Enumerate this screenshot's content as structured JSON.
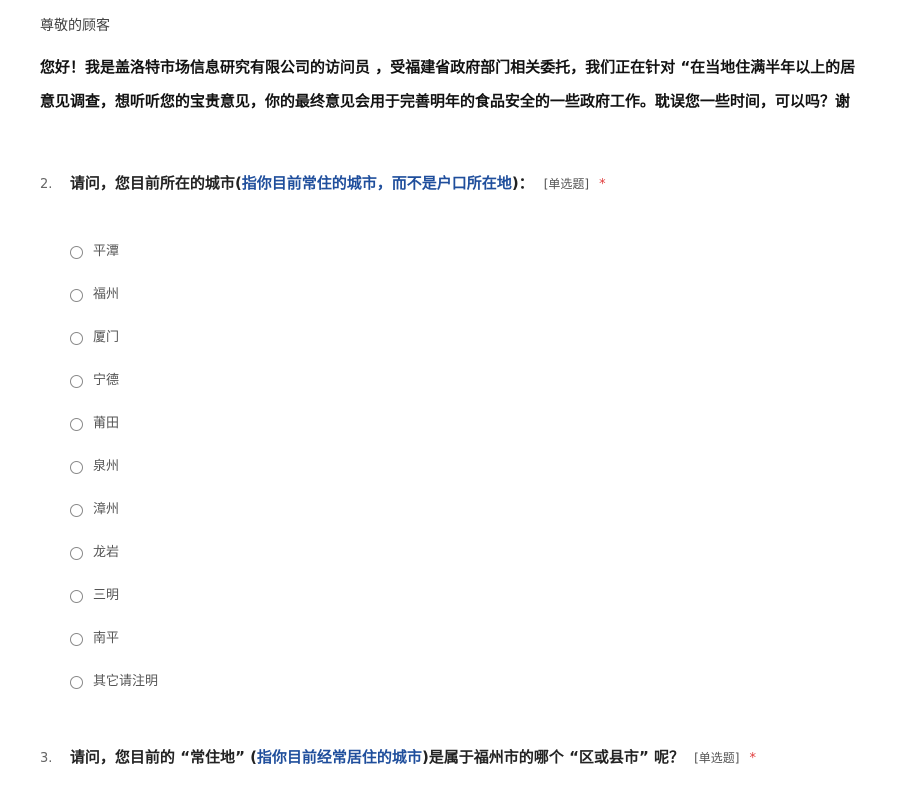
{
  "header": {
    "greeting": "尊敬的顾客",
    "intro_line1": "您好！我是盖洛特市场信息研究有限公司的访问员 ，受福建省政府部门相关委托，我们正在针对 “在当地住满半年以上的居",
    "intro_line2": "意见调查，想听听您的宝贵意见，你的最终意见会用于完善明年的食品安全的一些政府工作。耽误您一些时间，可以吗？谢"
  },
  "question2": {
    "number": "2.",
    "title_before": "请问，您目前所在的城市(",
    "hint": "指你目前常住的城市，而不是户口所在地",
    "title_after": ")：",
    "type": "[单选题]",
    "required": "*",
    "options": [
      "平潭",
      "福州",
      "厦门",
      "宁德",
      "莆田",
      "泉州",
      "漳州",
      "龙岩",
      "三明",
      "南平",
      "其它请注明"
    ]
  },
  "question3": {
    "number": "3.",
    "title_before": "请问，您目前的 “常住地” (",
    "hint": "指你目前经常居住的城市",
    "title_after": ")是属于福州市的哪个 “区或县市” 呢？",
    "type": "[单选题]",
    "required": "*"
  },
  "colors": {
    "hint_blue": "#1f4e9c",
    "required_red": "#e03a3a"
  }
}
